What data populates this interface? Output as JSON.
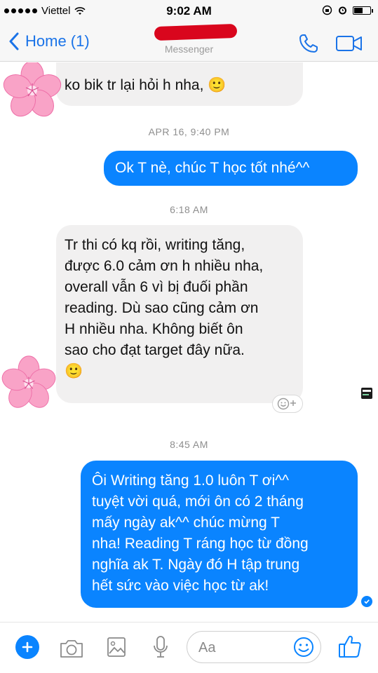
{
  "status_bar": {
    "carrier": "Viettel",
    "time": "9:02 AM",
    "signal_dots": 5,
    "battery_level": 0.55
  },
  "header": {
    "back_label": "Home (1)",
    "subtitle": "Messenger",
    "icons": [
      "phone-icon",
      "video-camera-icon"
    ]
  },
  "messages": [
    {
      "type": "incoming",
      "text": "ko bik tr lại hỏi h nha, 🙂"
    },
    {
      "type": "timestamp",
      "text": "APR 16, 9:40 PM"
    },
    {
      "type": "outgoing",
      "text": "Ok T nè, chúc T học tốt nhé^^"
    },
    {
      "type": "timestamp",
      "text": "6:18 AM"
    },
    {
      "type": "incoming",
      "text": "Tr thi có kq rồi, writing tăng,\nđược 6.0 cảm ơn h nhiều nha,\noverall vẫn 6 vì bị đuối phần\nreading. Dù sao cũng cảm ơn\nH nhiều nha. Không biết ôn\nsao cho đạt target đây nữa.\n🙂"
    },
    {
      "type": "timestamp",
      "text": "8:45 AM"
    },
    {
      "type": "outgoing",
      "text": "Ôi Writing tăng 1.0 luôn T ơi^^\ntuyệt vời quá, mới ôn có 2 tháng\nmấy ngày ak^^ chúc mừng T\nnha! Reading T ráng học từ đồng\nnghĩa ak T. Ngày đó H tập trung\nhết sức vào việc học từ ak!"
    }
  ],
  "composer": {
    "placeholder": "Aa",
    "icons": [
      "plus-icon",
      "camera-icon",
      "image-icon",
      "microphone-icon",
      "emoji-icon",
      "like-icon"
    ]
  },
  "colors": {
    "accent": "#0a84ff",
    "incoming_bubble": "#f1f0f0",
    "redaction": "#d9061d"
  }
}
